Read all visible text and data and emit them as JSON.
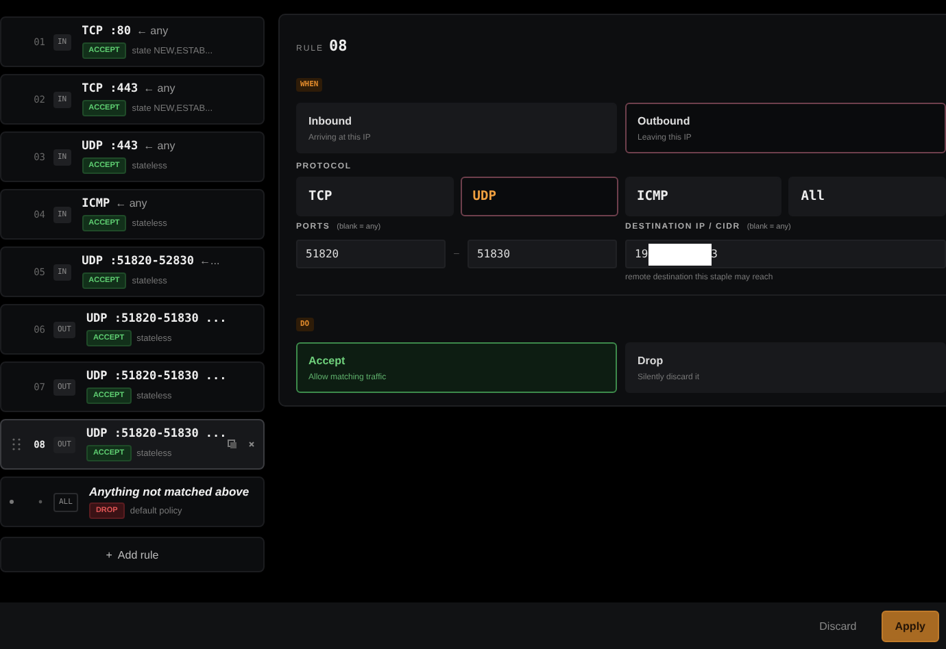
{
  "rules": [
    {
      "number": "01",
      "direction": "IN",
      "title": "TCP :80",
      "suffix": "← any",
      "action": "ACCEPT",
      "kind": "accept",
      "note": "state NEW,ESTAB...",
      "selected": false
    },
    {
      "number": "02",
      "direction": "IN",
      "title": "TCP :443",
      "suffix": "← any",
      "action": "ACCEPT",
      "kind": "accept",
      "note": "state NEW,ESTAB...",
      "selected": false
    },
    {
      "number": "03",
      "direction": "IN",
      "title": "UDP :443",
      "suffix": "← any",
      "action": "ACCEPT",
      "kind": "accept",
      "note": "stateless",
      "selected": false
    },
    {
      "number": "04",
      "direction": "IN",
      "title": "ICMP",
      "suffix": "← any",
      "action": "ACCEPT",
      "kind": "accept",
      "note": "stateless",
      "selected": false
    },
    {
      "number": "05",
      "direction": "IN",
      "title": "UDP :51820-52830",
      "suffix": "←...",
      "action": "ACCEPT",
      "kind": "accept",
      "note": "stateless",
      "selected": false
    },
    {
      "number": "06",
      "direction": "OUT",
      "title": "UDP :51820-51830 ...",
      "action": "ACCEPT",
      "kind": "accept",
      "note": "stateless",
      "selected": false
    },
    {
      "number": "07",
      "direction": "OUT",
      "title": "UDP :51820-51830 ...",
      "action": "ACCEPT",
      "kind": "accept",
      "note": "stateless",
      "selected": false
    },
    {
      "number": "08",
      "direction": "OUT",
      "title": "UDP :51820-51830 ...",
      "action": "ACCEPT",
      "kind": "accept",
      "note": "stateless",
      "selected": true
    }
  ],
  "default_rule": {
    "direction": "ALL",
    "title": "Anything not matched above",
    "action": "DROP",
    "kind": "drop",
    "note": "default policy"
  },
  "add_rule": {
    "icon": "+",
    "label": "Add rule"
  },
  "editor": {
    "label": "RULE",
    "number": "08",
    "when_tag": "WHEN",
    "directions": [
      {
        "title": "Inbound",
        "subtitle": "Arriving at this IP",
        "selected": false
      },
      {
        "title": "Outbound",
        "subtitle": "Leaving this IP",
        "selected": true
      }
    ],
    "protocol_label": "PROTOCOL",
    "protocols": [
      {
        "label": "TCP",
        "selected": false
      },
      {
        "label": "UDP",
        "selected": true
      },
      {
        "label": "ICMP",
        "selected": false
      },
      {
        "label": "All",
        "selected": false
      }
    ],
    "ports_label": "PORTS",
    "ports_hint": "(blank = any)",
    "port_from": "51820",
    "port_separator": "–",
    "port_to": "51830",
    "destination_label": "DESTINATION IP / CIDR",
    "destination_hint": "(blank = any)",
    "destination_start": "19",
    "destination_redacted": true,
    "destination_end": "3",
    "destination_help": "remote destination this staple may reach",
    "do_tag": "DO",
    "actions": [
      {
        "title": "Accept",
        "subtitle": "Allow matching traffic",
        "kind": "accept",
        "selected": true
      },
      {
        "title": "Drop",
        "subtitle": "Silently discard it",
        "kind": "drop",
        "selected": false
      }
    ]
  },
  "footer": {
    "discard": "Discard",
    "apply": "Apply"
  }
}
